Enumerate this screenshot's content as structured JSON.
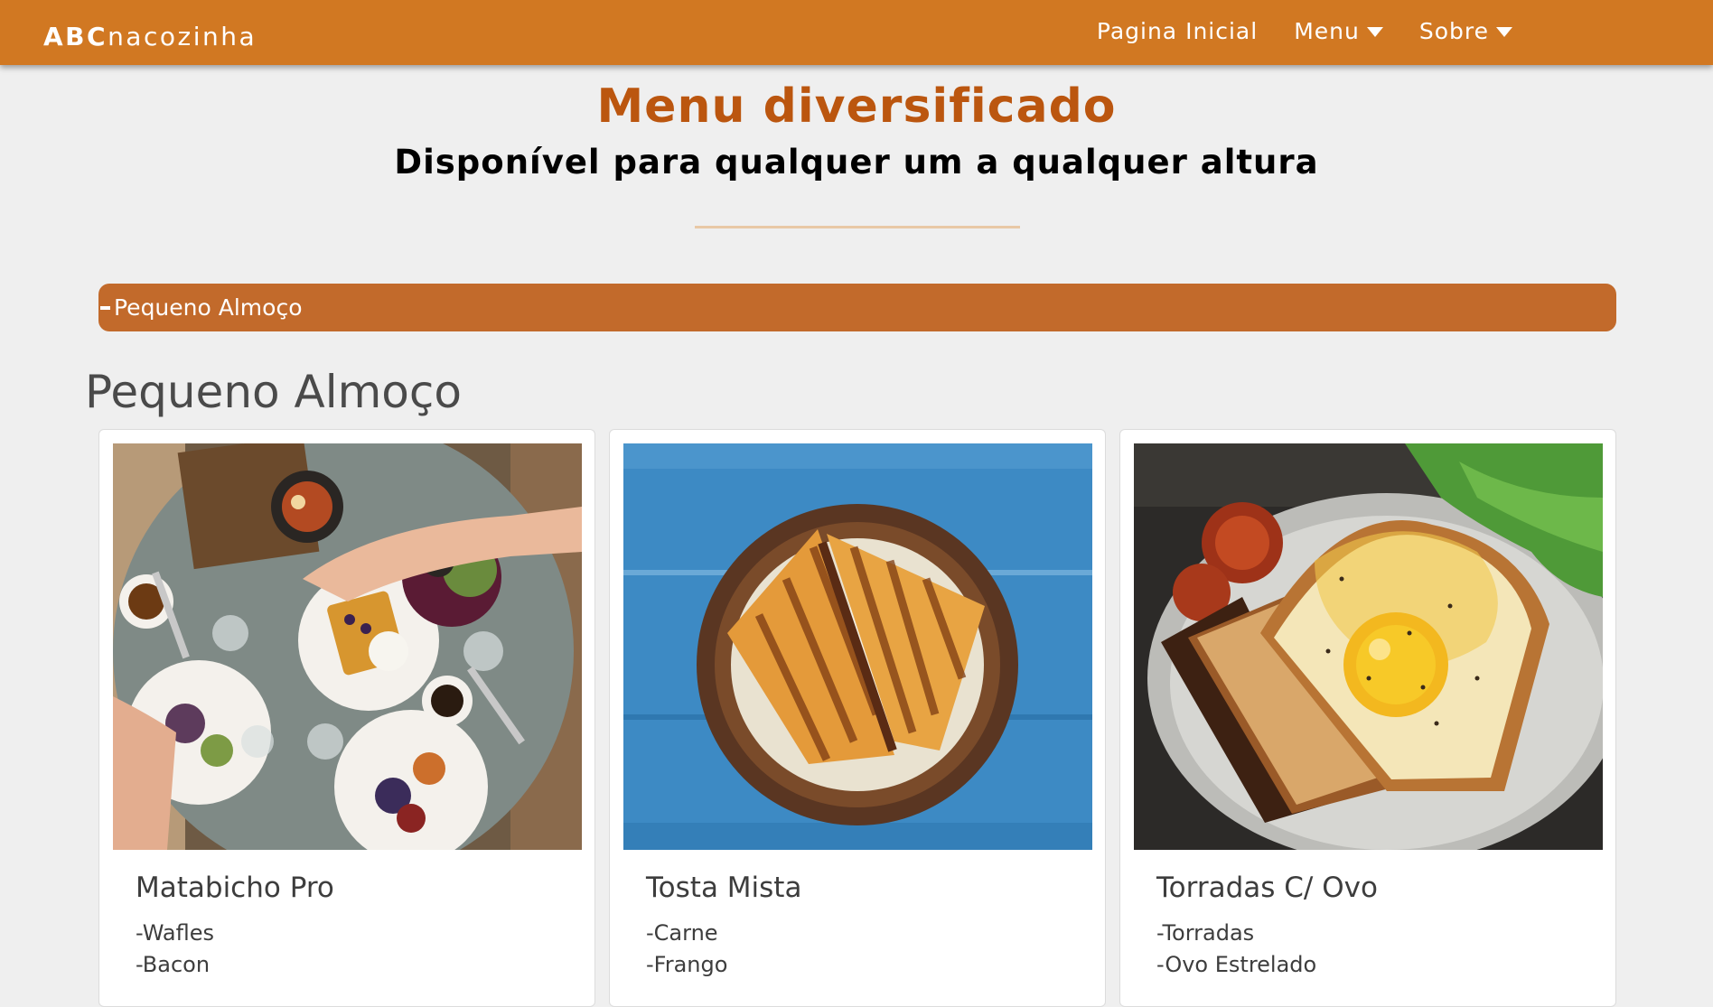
{
  "brand": {
    "bold": "ABC",
    "rest": "nacozinha"
  },
  "nav": {
    "items": [
      {
        "label": "Pagina Inicial",
        "has_caret": false
      },
      {
        "label": "Menu",
        "has_caret": true
      },
      {
        "label": "Sobre",
        "has_caret": true
      }
    ]
  },
  "hero": {
    "title": "Menu diversificado",
    "subtitle": "Disponível para qualquer um a qualquer altura"
  },
  "accordion": {
    "label": "Pequeno Almoço",
    "state_icon": "minus-icon"
  },
  "section": {
    "title": "Pequeno Almoço",
    "cards": [
      {
        "title": "Matabicho Pro",
        "image": "breakfast-table-photo",
        "items": [
          "-Wafles",
          "-Bacon"
        ]
      },
      {
        "title": "Tosta Mista",
        "image": "toasted-sandwich-photo",
        "items": [
          "-Carne",
          "-Frango"
        ]
      },
      {
        "title": "Torradas C/ Ovo",
        "image": "toast-with-egg-photo",
        "items": [
          "-Torradas",
          "-Ovo Estrelado"
        ]
      }
    ]
  },
  "colors": {
    "navbar": "#d17822",
    "accent_title": "#bb560f",
    "accordion": "#c26a2b",
    "page_bg": "#efefef"
  }
}
